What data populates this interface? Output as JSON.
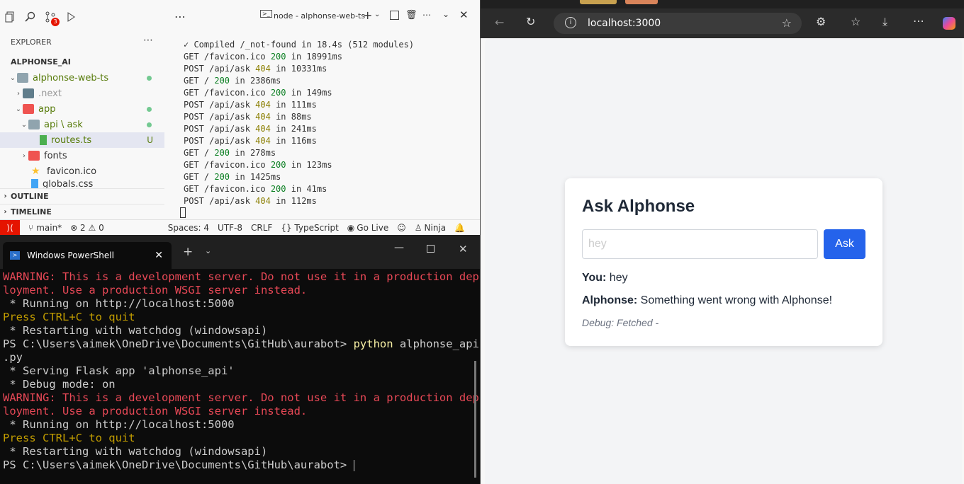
{
  "vscode": {
    "explorer_title": "EXPLORER",
    "workspace": "ALPHONSE_AI",
    "scm_badge": "3",
    "tree": [
      {
        "label": "alphonse-web-ts",
        "status": "dot"
      },
      {
        "label": ".next",
        "status": ""
      },
      {
        "label": "app",
        "status": "dot"
      },
      {
        "label": "api \\ ask",
        "status": "dot"
      },
      {
        "label": "routes.ts",
        "status": "U"
      },
      {
        "label": "fonts",
        "status": ""
      },
      {
        "label": "favicon.ico",
        "status": ""
      },
      {
        "label": "globals.css",
        "status": ""
      }
    ],
    "outline": "OUTLINE",
    "timeline": "TIMELINE",
    "terminal_tab": "node - alphonse-web-ts",
    "terminal_lines": [
      {
        "pre": "✓ Compiled /_not-found in 18.4s (512 modules)",
        "code": "",
        "post": ""
      },
      {
        "pre": "GET /favicon.ico ",
        "code": "200",
        "post": " in 18991ms"
      },
      {
        "pre": "POST /api/ask ",
        "code": "404",
        "post": " in 10331ms"
      },
      {
        "pre": "GET / ",
        "code": "200",
        "post": " in 2386ms"
      },
      {
        "pre": "GET /favicon.ico ",
        "code": "200",
        "post": " in 149ms"
      },
      {
        "pre": "POST /api/ask ",
        "code": "404",
        "post": " in 111ms"
      },
      {
        "pre": "POST /api/ask ",
        "code": "404",
        "post": " in 88ms"
      },
      {
        "pre": "POST /api/ask ",
        "code": "404",
        "post": " in 241ms"
      },
      {
        "pre": "POST /api/ask ",
        "code": "404",
        "post": " in 116ms"
      },
      {
        "pre": "GET / ",
        "code": "200",
        "post": " in 278ms"
      },
      {
        "pre": "GET /favicon.ico ",
        "code": "200",
        "post": " in 123ms"
      },
      {
        "pre": "GET / ",
        "code": "200",
        "post": " in 1425ms"
      },
      {
        "pre": "GET /favicon.ico ",
        "code": "200",
        "post": " in 41ms"
      },
      {
        "pre": "POST /api/ask ",
        "code": "404",
        "post": " in 112ms"
      }
    ],
    "status": {
      "branch": "main*",
      "problems": "⊗ 2 ⚠ 0",
      "spaces": "Spaces: 4",
      "encoding": "UTF-8",
      "eol": "CRLF",
      "language": "{} TypeScript",
      "golive": "Go Live",
      "ninja": "Ninja"
    }
  },
  "powershell": {
    "tab_title": "Windows PowerShell",
    "lines": [
      {
        "text": "WARNING: This is a development server. Do not use it in a production dep",
        "color": "red"
      },
      {
        "text": "loyment. Use a production WSGI server instead.",
        "color": "red"
      },
      {
        "text": " * Running on http://localhost:5000",
        "color": "normal"
      },
      {
        "text": "Press CTRL+C to quit",
        "color": "yellow"
      },
      {
        "text": " * Restarting with watchdog (windowsapi)",
        "color": "normal"
      },
      {
        "text": "PS C:\\Users\\aimek\\OneDrive\\Documents\\GitHub\\aurabot> ",
        "color": "normal",
        "cmd": "python",
        "args": " alphonse_api"
      },
      {
        "text": ".py",
        "color": "normal"
      },
      {
        "text": " * Serving Flask app 'alphonse_api'",
        "color": "normal"
      },
      {
        "text": " * Debug mode: on",
        "color": "normal"
      },
      {
        "text": "WARNING: This is a development server. Do not use it in a production dep",
        "color": "red"
      },
      {
        "text": "loyment. Use a production WSGI server instead.",
        "color": "red"
      },
      {
        "text": " * Running on http://localhost:5000",
        "color": "normal"
      },
      {
        "text": "Press CTRL+C to quit",
        "color": "yellow"
      },
      {
        "text": " * Restarting with watchdog (windowsapi)",
        "color": "normal"
      },
      {
        "text": "PS C:\\Users\\aimek\\OneDrive\\Documents\\GitHub\\aurabot> ",
        "color": "normal"
      }
    ]
  },
  "browser": {
    "url": "localhost:3000",
    "card": {
      "title": "Ask Alphonse",
      "input_value": "",
      "input_placeholder": "hey",
      "ask_button": "Ask",
      "you_label": "You:",
      "you_text": " hey",
      "alphonse_label": "Alphonse:",
      "alphonse_text": " Something went wrong with Alphonse!",
      "debug": "Debug: Fetched -"
    }
  }
}
